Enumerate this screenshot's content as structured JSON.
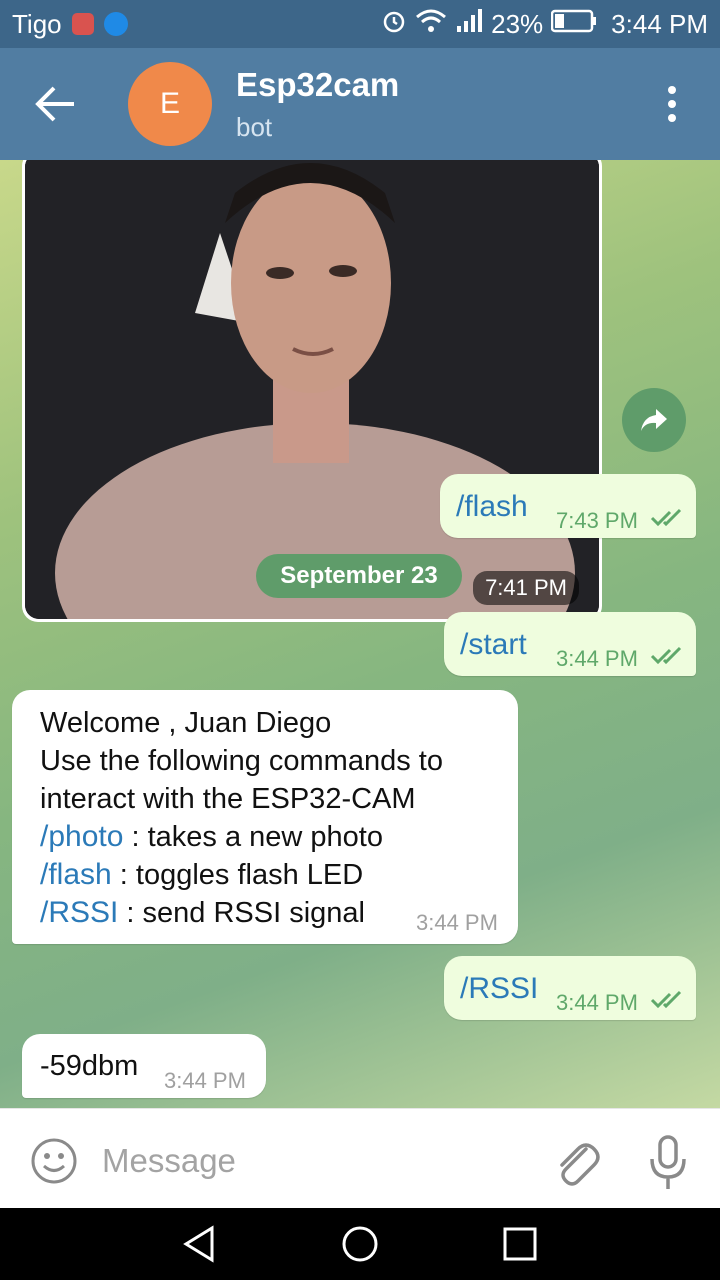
{
  "status": {
    "carrier": "Tigo",
    "battery": "23%",
    "time": "3:44 PM"
  },
  "header": {
    "avatar_letter": "E",
    "name": "Esp32cam",
    "subtitle": "bot"
  },
  "messages": {
    "photo_time": "7:41 PM",
    "flash_cmd": "/flash",
    "flash_time": "7:43 PM",
    "date_separator": "September 23",
    "start_cmd": "/start",
    "start_time": "3:44 PM",
    "welcome": {
      "line1": "Welcome , Juan Diego",
      "line2": "Use the following commands to",
      "line3": "interact with the ESP32-CAM",
      "cmd_photo": "/photo",
      "desc_photo": " : takes a new photo",
      "cmd_flash": "/flash",
      "desc_flash": " : toggles flash LED",
      "cmd_rssi": "/RSSI",
      "desc_rssi": " : send RSSI signal",
      "time": "3:44 PM"
    },
    "rssi_cmd": "/RSSI",
    "rssi_time": "3:44 PM",
    "rssi_reply": "-59dbm",
    "rssi_reply_time": "3:44 PM"
  },
  "input": {
    "placeholder": "Message"
  },
  "colors": {
    "header": "#517da2",
    "status_bar": "#3d6689",
    "outgoing_bubble": "#effdde",
    "link": "#2b7ab8",
    "accent_green": "#5f9c6a"
  }
}
